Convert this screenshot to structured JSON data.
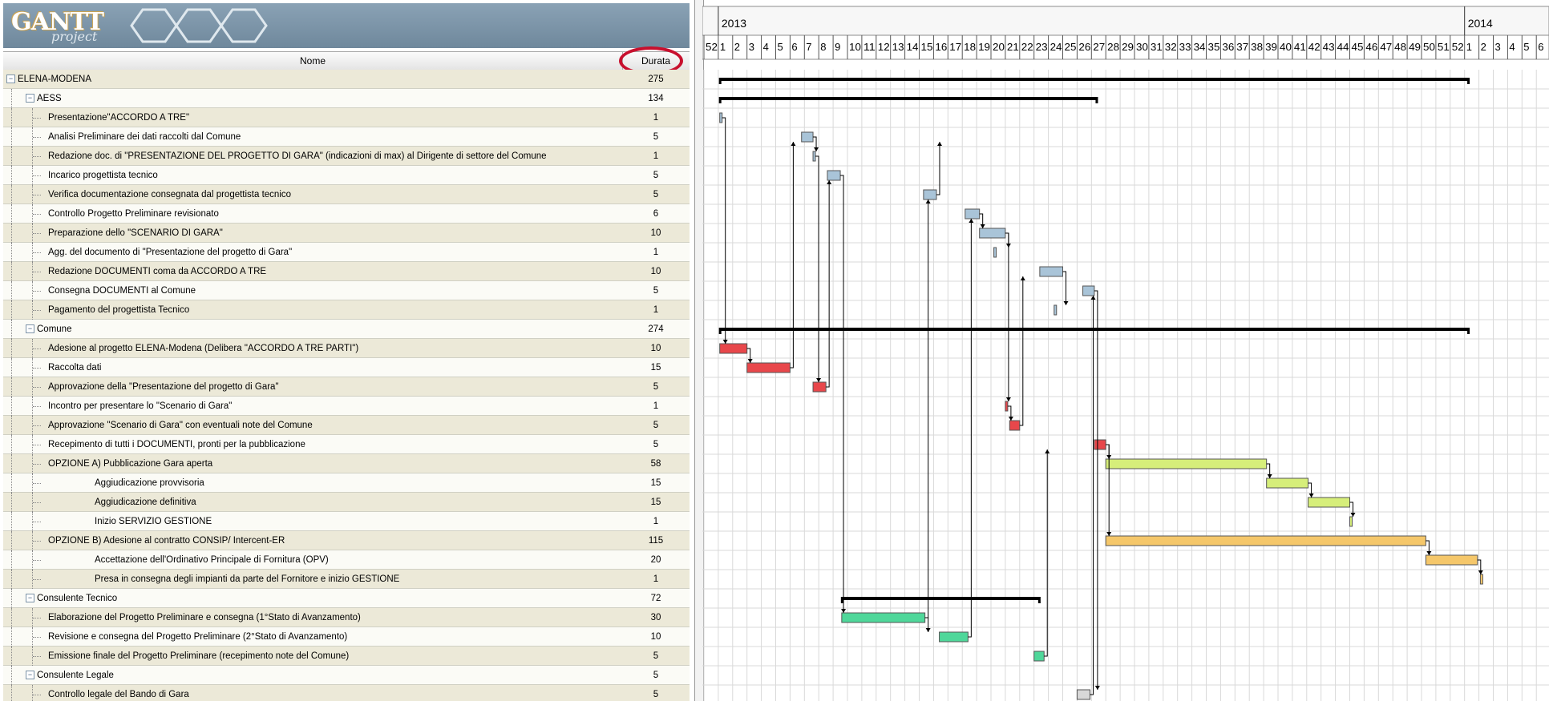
{
  "app": {
    "logo_text": "GANTT",
    "logo_sub": "project"
  },
  "columns": {
    "name": "Nome",
    "duration": "Durata"
  },
  "tasks": [
    {
      "name": "ELENA-MODENA",
      "dur": "275",
      "level": 0,
      "group": true
    },
    {
      "name": "AESS",
      "dur": "134",
      "level": 1,
      "group": true
    },
    {
      "name": "Presentazione\"ACCORDO A TRE\"",
      "dur": "1",
      "level": 2
    },
    {
      "name": "Analisi Preliminare dei dati raccolti dal Comune",
      "dur": "5",
      "level": 2
    },
    {
      "name": "Redazione doc. di \"PRESENTAZIONE DEL PROGETTO DI GARA\" (indicazioni di max) al Dirigente di settore del Comune",
      "dur": "1",
      "level": 2
    },
    {
      "name": "Incarico progettista tecnico",
      "dur": "5",
      "level": 2
    },
    {
      "name": "Verifica documentazione consegnata dal progettista tecnico",
      "dur": "5",
      "level": 2
    },
    {
      "name": "Controllo Progetto Preliminare revisionato",
      "dur": "6",
      "level": 2
    },
    {
      "name": "Preparazione dello \"SCENARIO DI GARA\"",
      "dur": "10",
      "level": 2
    },
    {
      "name": "Agg. del documento di \"Presentazione del progetto di Gara\"",
      "dur": "1",
      "level": 2
    },
    {
      "name": "Redazione DOCUMENTI coma da ACCORDO A TRE",
      "dur": "10",
      "level": 2
    },
    {
      "name": "Consegna DOCUMENTI al Comune",
      "dur": "5",
      "level": 2
    },
    {
      "name": "Pagamento del progettista Tecnico",
      "dur": "1",
      "level": 2
    },
    {
      "name": "Comune",
      "dur": "274",
      "level": 1,
      "group": true
    },
    {
      "name": "Adesione al progetto ELENA-Modena (Delibera \"ACCORDO A TRE PARTI\")",
      "dur": "10",
      "level": 2
    },
    {
      "name": "Raccolta dati",
      "dur": "15",
      "level": 2
    },
    {
      "name": "Approvazione della \"Presentazione del progetto di Gara\"",
      "dur": "5",
      "level": 2
    },
    {
      "name": "Incontro per presentare lo \"Scenario di Gara\"",
      "dur": "1",
      "level": 2
    },
    {
      "name": "Approvazione \"Scenario di Gara\" con eventuali note del Comune",
      "dur": "5",
      "level": 2
    },
    {
      "name": "Recepimento di tutti i DOCUMENTI, pronti per la pubblicazione",
      "dur": "5",
      "level": 2
    },
    {
      "name": "OPZIONE A) Pubblicazione Gara aperta",
      "dur": "58",
      "level": 2
    },
    {
      "name": "Aggiudicazione provvisoria",
      "dur": "15",
      "level": 3
    },
    {
      "name": "Aggiudicazione definitiva",
      "dur": "15",
      "level": 3
    },
    {
      "name": "Inizio SERVIZIO GESTIONE",
      "dur": "1",
      "level": 3
    },
    {
      "name": "OPZIONE B) Adesione al contratto CONSIP/ Intercent-ER",
      "dur": "115",
      "level": 2
    },
    {
      "name": "Accettazione dell'Ordinativo Principale di Fornitura (OPV)",
      "dur": "20",
      "level": 3
    },
    {
      "name": "Presa in consegna degli impianti da parte del Fornitore e inizio GESTIONE",
      "dur": "1",
      "level": 3
    },
    {
      "name": "Consulente Tecnico",
      "dur": "72",
      "level": 1,
      "group": true
    },
    {
      "name": "Elaborazione del Progetto Preliminare e consegna (1°Stato di Avanzamento)",
      "dur": "30",
      "level": 2
    },
    {
      "name": "Revisione e consegna del Progetto Preliminare (2°Stato di Avanzamento)",
      "dur": "10",
      "level": 2
    },
    {
      "name": "Emissione finale del Progetto Preliminare (recepimento note del Comune)",
      "dur": "5",
      "level": 2
    },
    {
      "name": "Consulente Legale",
      "dur": "5",
      "level": 1,
      "group": true
    },
    {
      "name": "Controllo legale del Bando di Gara",
      "dur": "5",
      "level": 2
    }
  ],
  "timeline": {
    "years": [
      {
        "label": "2013",
        "week": 1
      },
      {
        "label": "2014",
        "week": 53
      }
    ],
    "weeks": [
      "52",
      "1",
      "2",
      "3",
      "4",
      "5",
      "6",
      "7",
      "8",
      "9",
      "10",
      "11",
      "12",
      "13",
      "14",
      "15",
      "16",
      "17",
      "18",
      "19",
      "20",
      "21",
      "22",
      "23",
      "24",
      "25",
      "26",
      "27",
      "28",
      "29",
      "30",
      "31",
      "32",
      "33",
      "34",
      "35",
      "36",
      "37",
      "38",
      "39",
      "40",
      "41",
      "42",
      "43",
      "44",
      "45",
      "46",
      "47",
      "48",
      "49",
      "50",
      "51",
      "52",
      "1",
      "2",
      "3",
      "4",
      "5",
      "6"
    ]
  },
  "colors": {
    "aess": "#a9c4d8",
    "comune": "#e8474b",
    "opzione_a": "#d6ee7a",
    "opzione_b": "#f5c76a",
    "consulente_tecnico": "#4fd79a",
    "consulente_legale": "#d8d8d8",
    "summary": "#000000",
    "highlight_ring": "#c8102e"
  },
  "gantt": {
    "summaries": [
      {
        "row": 0,
        "start": 1.1,
        "end": 53.3
      },
      {
        "row": 1,
        "start": 1.1,
        "end": 27.4
      },
      {
        "row": 13,
        "start": 1.1,
        "end": 53.3
      },
      {
        "row": 27,
        "start": 9.6,
        "end": 23.4
      }
    ],
    "bars": [
      {
        "row": 2,
        "start": 1.1,
        "end": 1.2,
        "color": "aess"
      },
      {
        "row": 3,
        "start": 6.8,
        "end": 7.6,
        "color": "aess"
      },
      {
        "row": 4,
        "start": 7.6,
        "end": 7.7,
        "color": "aess"
      },
      {
        "row": 5,
        "start": 8.6,
        "end": 9.5,
        "color": "aess"
      },
      {
        "row": 6,
        "start": 15.3,
        "end": 16.2,
        "color": "aess"
      },
      {
        "row": 7,
        "start": 18.2,
        "end": 19.2,
        "color": "aess"
      },
      {
        "row": 8,
        "start": 19.2,
        "end": 21.0,
        "color": "aess"
      },
      {
        "row": 9,
        "start": 20.2,
        "end": 20.3,
        "color": "aess"
      },
      {
        "row": 10,
        "start": 23.4,
        "end": 25.0,
        "color": "aess"
      },
      {
        "row": 11,
        "start": 26.4,
        "end": 27.2,
        "color": "aess"
      },
      {
        "row": 12,
        "start": 24.4,
        "end": 24.5,
        "color": "aess"
      },
      {
        "row": 14,
        "start": 1.1,
        "end": 3.0,
        "color": "comune"
      },
      {
        "row": 15,
        "start": 3.0,
        "end": 6.0,
        "color": "comune"
      },
      {
        "row": 16,
        "start": 7.6,
        "end": 8.5,
        "color": "comune"
      },
      {
        "row": 17,
        "start": 21.0,
        "end": 21.1,
        "color": "comune"
      },
      {
        "row": 18,
        "start": 21.3,
        "end": 22.0,
        "color": "comune"
      },
      {
        "row": 19,
        "start": 27.2,
        "end": 28.0,
        "color": "comune"
      },
      {
        "row": 20,
        "start": 28.0,
        "end": 39.2,
        "color": "opzione_a"
      },
      {
        "row": 21,
        "start": 39.2,
        "end": 42.1,
        "color": "opzione_a"
      },
      {
        "row": 22,
        "start": 42.1,
        "end": 45.0,
        "color": "opzione_a"
      },
      {
        "row": 23,
        "start": 45.0,
        "end": 45.1,
        "color": "opzione_a"
      },
      {
        "row": 24,
        "start": 28.0,
        "end": 50.3,
        "color": "opzione_b"
      },
      {
        "row": 25,
        "start": 50.3,
        "end": 53.9,
        "color": "opzione_b"
      },
      {
        "row": 26,
        "start": 54.1,
        "end": 54.2,
        "color": "opzione_b"
      },
      {
        "row": 28,
        "start": 9.6,
        "end": 15.4,
        "color": "consulente_tecnico"
      },
      {
        "row": 29,
        "start": 16.4,
        "end": 18.4,
        "color": "consulente_tecnico"
      },
      {
        "row": 30,
        "start": 23.0,
        "end": 23.7,
        "color": "consulente_tecnico"
      },
      {
        "row": 32,
        "start": 26.0,
        "end": 26.9,
        "color": "consulente_legale"
      }
    ],
    "deps": [
      {
        "from": 2,
        "to": 14
      },
      {
        "from": 3,
        "to": 4
      },
      {
        "from": 5,
        "to": 28
      },
      {
        "from": 6,
        "to": 3
      },
      {
        "from": 7,
        "to": 8
      },
      {
        "from": 8,
        "to": 9
      },
      {
        "from": 8,
        "to": 17
      },
      {
        "from": 10,
        "to": 12
      },
      {
        "from": 11,
        "to": 32
      },
      {
        "from": 14,
        "to": 15
      },
      {
        "from": 15,
        "to": 3
      },
      {
        "from": 4,
        "to": 16
      },
      {
        "from": 16,
        "to": 5
      },
      {
        "from": 17,
        "to": 18
      },
      {
        "from": 18,
        "to": 10
      },
      {
        "from": 19,
        "to": 20
      },
      {
        "from": 19,
        "to": 24
      },
      {
        "from": 20,
        "to": 21
      },
      {
        "from": 21,
        "to": 22
      },
      {
        "from": 22,
        "to": 23
      },
      {
        "from": 24,
        "to": 25
      },
      {
        "from": 25,
        "to": 26
      },
      {
        "from": 28,
        "to": 6
      },
      {
        "from": 28,
        "to": 29
      },
      {
        "from": 29,
        "to": 7
      },
      {
        "from": 30,
        "to": 19
      },
      {
        "from": 32,
        "to": 11
      }
    ]
  }
}
